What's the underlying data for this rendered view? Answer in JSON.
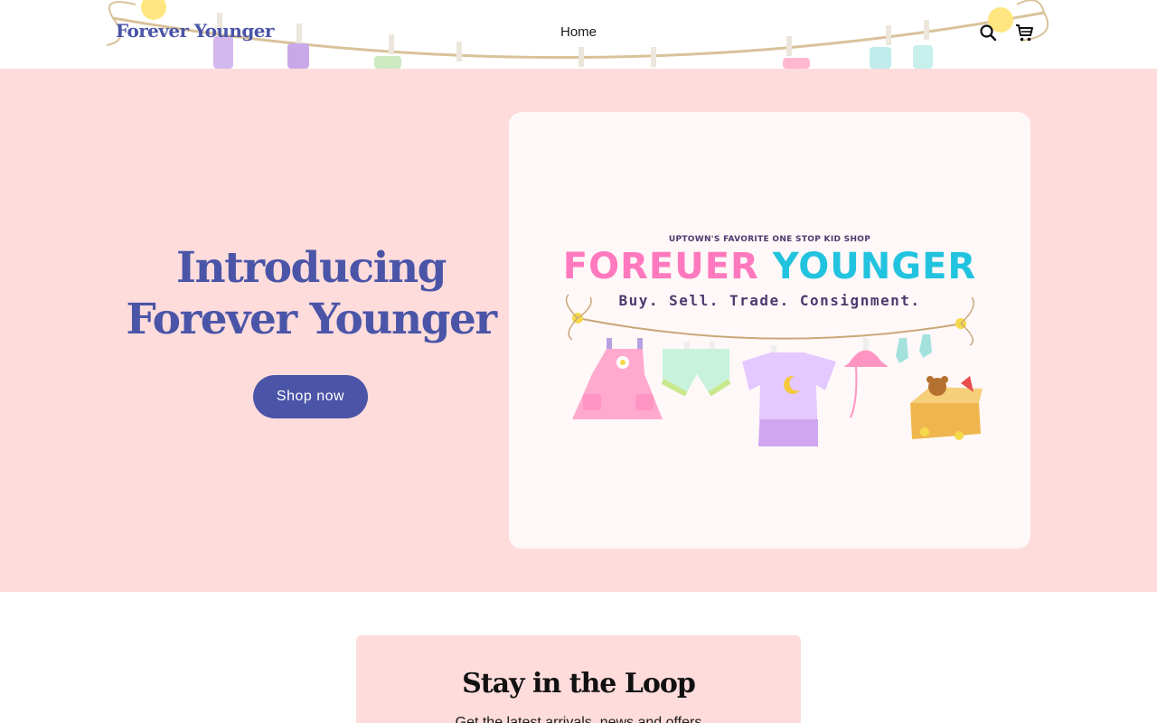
{
  "header": {
    "logo": "Forever Younger",
    "nav": [
      {
        "label": "Home"
      }
    ],
    "icons": [
      "search-icon",
      "cart-icon"
    ]
  },
  "hero": {
    "title_line1": "Introducing",
    "title_line2": "Forever Younger",
    "cta_label": "Shop now",
    "card": {
      "tagline": "UPTOWN'S FAVORITE ONE STOP KID SHOP",
      "brand_part1": "FOREUER",
      "brand_part2": "YOUNGER",
      "subline": "Buy. Sell. Trade. Consignment."
    }
  },
  "newsletter": {
    "title": "Stay in the Loop",
    "text": "Get the latest arrivals, news and offers"
  },
  "colors": {
    "brand": "#4a55a8",
    "hero_bg": "#ffdcdc",
    "card_bg": "#fff8f8",
    "pink": "#ff79bf",
    "cyan": "#22c3df"
  }
}
